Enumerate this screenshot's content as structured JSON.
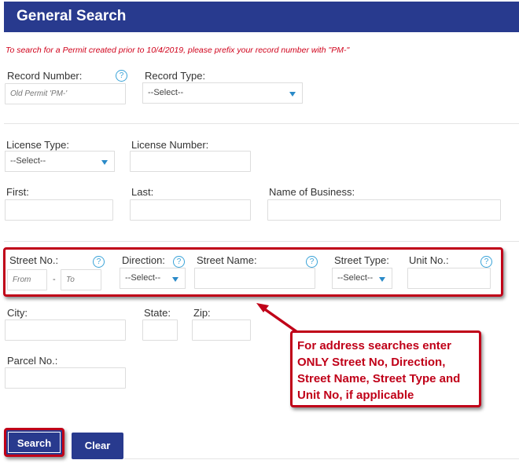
{
  "header": {
    "title": "General Search"
  },
  "notice": "To search for a Permit created prior to 10/4/2019, please prefix your record number with \"PM-\"",
  "record": {
    "number_label": "Record Number:",
    "number_placeholder": "Old Permit 'PM-'",
    "type_label": "Record Type:",
    "type_value": "--Select--"
  },
  "license": {
    "type_label": "License Type:",
    "type_value": "--Select--",
    "number_label": "License Number:",
    "number_value": ""
  },
  "name": {
    "first_label": "First:",
    "last_label": "Last:",
    "business_label": "Name of Business:"
  },
  "address": {
    "street_no_label": "Street No.:",
    "from_placeholder": "From",
    "to_placeholder": "To",
    "dash": "-",
    "direction_label": "Direction:",
    "direction_value": "--Select--",
    "street_name_label": "Street Name:",
    "street_type_label": "Street Type:",
    "street_type_value": "--Select--",
    "unit_no_label": "Unit No.:",
    "city_label": "City:",
    "state_label": "State:",
    "zip_label": "Zip:",
    "parcel_label": "Parcel No.:"
  },
  "help_glyph": "?",
  "callout": "For address searches enter ONLY Street No, Direction, Street Name, Street Type and Unit No, if applicable",
  "buttons": {
    "search": "Search",
    "clear": "Clear"
  },
  "colors": {
    "brand": "#283a8e",
    "highlight": "#c00018",
    "help": "#3aa3d8",
    "notice": "#d0021b"
  }
}
